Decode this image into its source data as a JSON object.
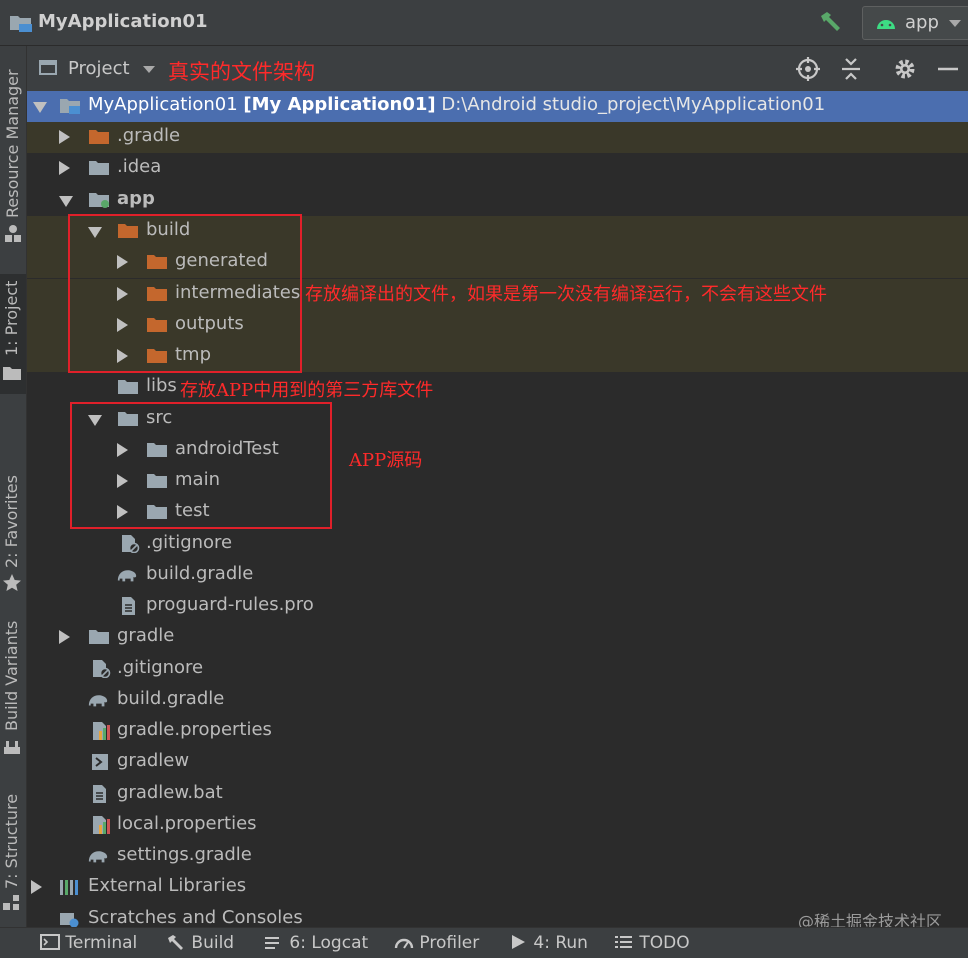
{
  "titlebar": {
    "title": "MyApplication01",
    "run_config": "app"
  },
  "left_tabs": [
    {
      "label": "Resource Manager"
    },
    {
      "label": "1: Project"
    },
    {
      "label": "2: Favorites"
    },
    {
      "label": "Build Variants"
    },
    {
      "label": "7: Structure"
    }
  ],
  "panel": {
    "view_label": "Project",
    "annotation": "真实的文件架构"
  },
  "tree": {
    "root_name": "MyApplication01",
    "root_module": "[My Application01]",
    "root_path": "D:\\Android studio_project\\MyApplication01",
    "items": [
      {
        "label": ".gradle"
      },
      {
        "label": ".idea"
      },
      {
        "label": "app"
      },
      {
        "label": "build"
      },
      {
        "label": "generated"
      },
      {
        "label": "intermediates"
      },
      {
        "label": "outputs"
      },
      {
        "label": "tmp"
      },
      {
        "label": "libs"
      },
      {
        "label": "src"
      },
      {
        "label": "androidTest"
      },
      {
        "label": "main"
      },
      {
        "label": "test"
      },
      {
        "label": ".gitignore"
      },
      {
        "label": "build.gradle"
      },
      {
        "label": "proguard-rules.pro"
      },
      {
        "label": "gradle"
      },
      {
        "label": ".gitignore"
      },
      {
        "label": "build.gradle"
      },
      {
        "label": "gradle.properties"
      },
      {
        "label": "gradlew"
      },
      {
        "label": "gradlew.bat"
      },
      {
        "label": "local.properties"
      },
      {
        "label": "settings.gradle"
      },
      {
        "label": "External Libraries"
      },
      {
        "label": "Scratches and Consoles"
      }
    ]
  },
  "annotations": {
    "build_note": "存放编译出的文件，如果是第一次没有编译运行，不会有这些文件",
    "libs_note": "存放APP中用到的第三方库文件",
    "src_note": "APP源码"
  },
  "bottom_tabs": [
    {
      "label": "Terminal"
    },
    {
      "label": "Build"
    },
    {
      "label": "6: Logcat"
    },
    {
      "label": "Profiler"
    },
    {
      "label": "4: Run"
    },
    {
      "label": "TODO"
    }
  ],
  "watermark": "@稀土掘金技术社区",
  "colors": {
    "folder_orange": "#c4672d",
    "folder_gray": "#9aa7b0",
    "selection": "#4b6eaf",
    "annotation_red": "#ff2a2a"
  }
}
